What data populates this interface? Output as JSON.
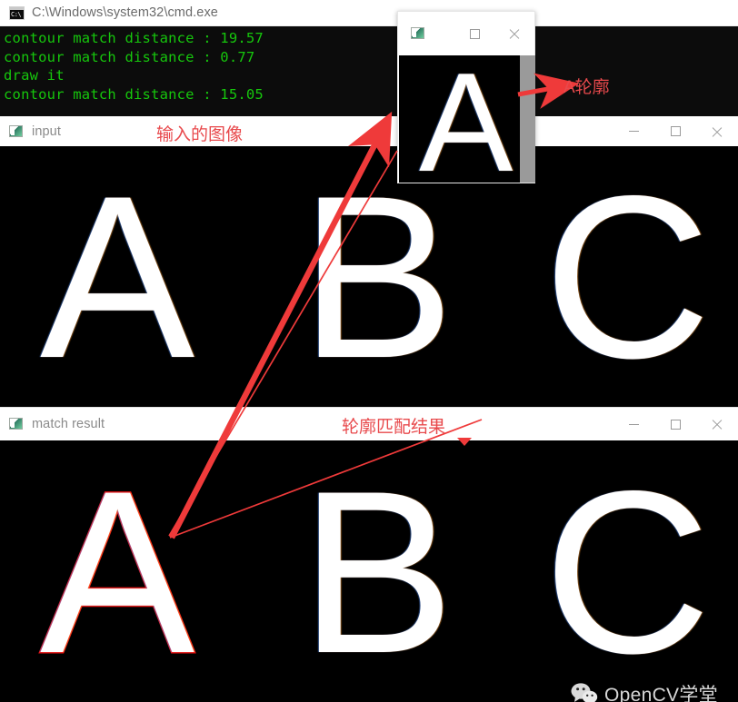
{
  "cmd_window": {
    "icon": "cmd-icon",
    "title": "C:\\Windows\\system32\\cmd.exe",
    "console_lines": [
      "contour match distance : 19.57",
      "contour match distance : 0.77",
      "draw it",
      "contour match distance : 15.05"
    ],
    "text_color": "#16c60c",
    "bg_color": "#0c0c0c"
  },
  "input_window": {
    "icon": "opencv-window-icon",
    "title": "input",
    "annotation": "输入的图像",
    "letters": [
      "A",
      "B",
      "C"
    ],
    "minimize_label": "—",
    "maximize_label": "□",
    "close_label": "✕"
  },
  "popup_window": {
    "icon": "opencv-window-icon",
    "title": "",
    "letter": "A",
    "annotation": "A轮廓",
    "maximize_label": "□",
    "close_label": "✕"
  },
  "match_window": {
    "icon": "opencv-window-icon",
    "title": "match result",
    "annotation": "轮廓匹配结果",
    "letters": [
      "A",
      "B",
      "C"
    ],
    "outlined_letter": "A",
    "contour_color": "#ee1111",
    "minimize_label": "—",
    "maximize_label": "□",
    "close_label": "✕"
  },
  "watermark": {
    "text": "OpenCV学堂",
    "icon": "wechat-icon"
  },
  "colors": {
    "annotation_red": "#e8494c",
    "arrow_red": "#ef3a3a",
    "console_green": "#16c60c",
    "title_gray": "#8a8a8a"
  }
}
